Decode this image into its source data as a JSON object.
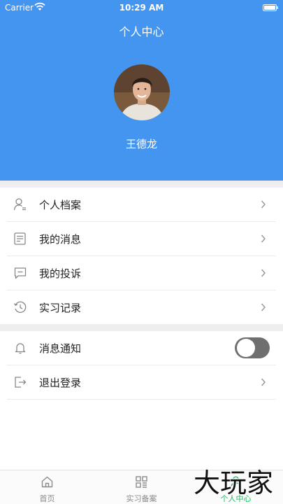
{
  "status_bar": {
    "carrier": "Carrier",
    "time": "10:29 AM"
  },
  "header": {
    "title": "个人中心",
    "user_name": "王德龙",
    "background_color": "#4495f0"
  },
  "menu_group_1": [
    {
      "label": "个人档案",
      "icon": "user-profile-icon"
    },
    {
      "label": "我的消息",
      "icon": "message-document-icon"
    },
    {
      "label": "我的投诉",
      "icon": "chat-bubble-icon"
    },
    {
      "label": "实习记录",
      "icon": "history-clock-icon"
    }
  ],
  "menu_group_2": {
    "notifications": {
      "label": "消息通知",
      "icon": "bell-icon",
      "enabled": false
    },
    "logout": {
      "label": "退出登录",
      "icon": "logout-icon"
    }
  },
  "tabbar": {
    "tabs": [
      {
        "label": "首页",
        "icon": "home-icon",
        "active": false
      },
      {
        "label": "实习备案",
        "icon": "grid-icon",
        "active": false
      },
      {
        "label": "个人中心",
        "icon": "person-icon",
        "active": true
      }
    ],
    "active_color": "#1dbe5f"
  },
  "watermark": {
    "text": "大玩家"
  }
}
